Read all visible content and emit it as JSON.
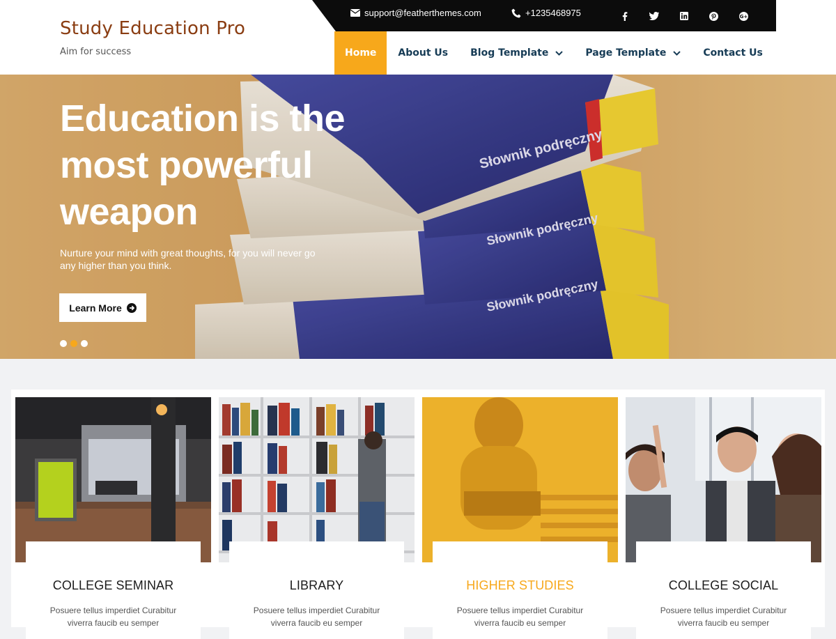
{
  "site": {
    "title": "Study Education Pro",
    "tagline": "Aim for success"
  },
  "topbar": {
    "email": "support@featherthemes.com",
    "phone": "+1235468975",
    "social": [
      "facebook-icon",
      "twitter-icon",
      "linkedin-icon",
      "pinterest-icon",
      "google-plus-icon"
    ]
  },
  "nav": {
    "items": [
      {
        "label": "Home",
        "active": true
      },
      {
        "label": "About Us"
      },
      {
        "label": "Blog Template",
        "has_dropdown": true
      },
      {
        "label": "Page Template",
        "has_dropdown": true
      },
      {
        "label": "Contact Us"
      }
    ]
  },
  "hero": {
    "heading": "Education is the most powerful weapon",
    "subtext": "Nurture your mind with great thoughts, for you will never go any higher than you think.",
    "button_label": "Learn More",
    "slides": 3,
    "active_slide": 2
  },
  "cards": [
    {
      "title": "COLLEGE SEMINAR",
      "text": "Posuere tellus imperdiet Curabitur viverra faucib eu semper"
    },
    {
      "title": "LIBRARY",
      "text": "Posuere tellus imperdiet Curabitur viverra faucib eu semper"
    },
    {
      "title": "HIGHER STUDIES",
      "text": "Posuere tellus imperdiet Curabitur viverra faucib eu semper"
    },
    {
      "title": "COLLEGE SOCIAL",
      "text": "Posuere tellus imperdiet Curabitur viverra faucib eu semper"
    }
  ],
  "colors": {
    "accent": "#f7a81b",
    "brand_title": "#8a3d12",
    "nav_text": "#173c56",
    "topbar_bg": "#0c0c0c"
  }
}
